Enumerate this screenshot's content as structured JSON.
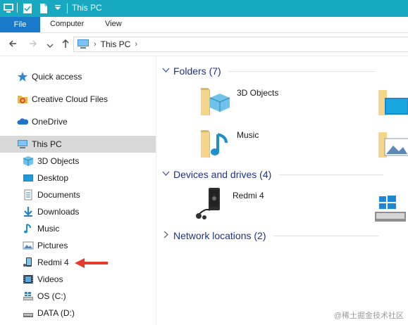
{
  "window": {
    "title": "This PC"
  },
  "ribbon": {
    "file": "File",
    "computer": "Computer",
    "view": "View"
  },
  "address": {
    "crumb": "This PC"
  },
  "sidebar": {
    "items": [
      {
        "label": "Quick access",
        "icon": "quick-access-star-icon"
      },
      {
        "label": "Creative Cloud Files",
        "icon": "creative-cloud-icon"
      },
      {
        "label": "OneDrive",
        "icon": "onedrive-cloud-icon"
      },
      {
        "label": "This PC",
        "icon": "this-pc-icon",
        "selected": true
      },
      {
        "label": "3D Objects",
        "icon": "3d-objects-icon"
      },
      {
        "label": "Desktop",
        "icon": "desktop-icon"
      },
      {
        "label": "Documents",
        "icon": "documents-icon"
      },
      {
        "label": "Downloads",
        "icon": "downloads-icon"
      },
      {
        "label": "Music",
        "icon": "music-icon"
      },
      {
        "label": "Pictures",
        "icon": "pictures-icon"
      },
      {
        "label": "Redmi 4",
        "icon": "phone-device-icon"
      },
      {
        "label": "Videos",
        "icon": "videos-icon"
      },
      {
        "label": "OS (C:)",
        "icon": "os-drive-icon"
      },
      {
        "label": "DATA (D:)",
        "icon": "data-drive-icon"
      }
    ]
  },
  "content": {
    "folders_header": "Folders (7)",
    "folders": [
      {
        "name": "3D Objects"
      },
      {
        "name": "Music"
      }
    ],
    "devices_header": "Devices and drives (4)",
    "devices": [
      {
        "name": "Redmi 4"
      }
    ],
    "network_header": "Network locations (2)"
  },
  "watermark": "@稀土掘金技术社区",
  "colors": {
    "titlebar": "#18a8bf",
    "file_tab": "#1979ca",
    "group_header": "#1e3287",
    "selection": "#d9d9d9",
    "arrow": "#e53a2b"
  }
}
